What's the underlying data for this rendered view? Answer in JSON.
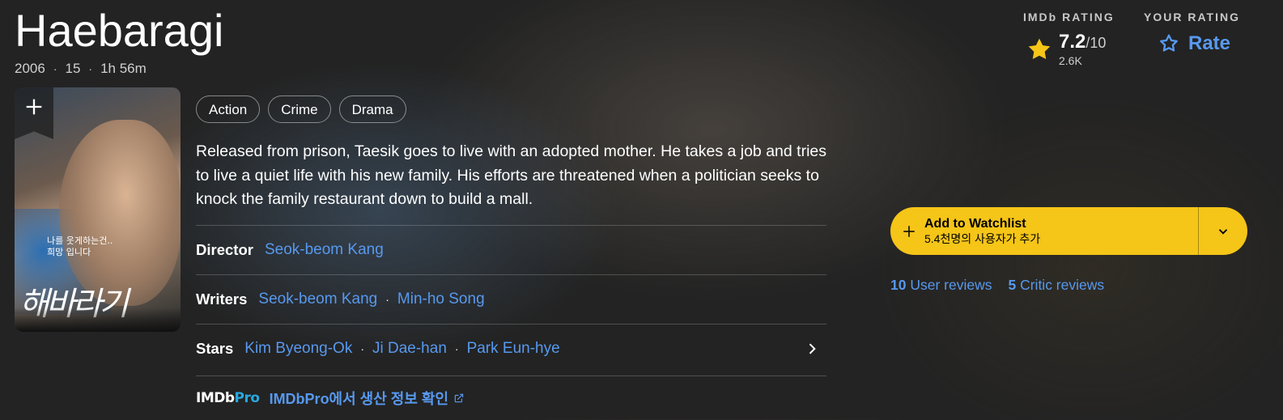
{
  "title": {
    "name": "Haebaragi",
    "year": "2006",
    "certificate": "15",
    "runtime": "1h 56m"
  },
  "poster": {
    "text_line1": "나를 웃게하는건..",
    "text_line2": "희망 입니다",
    "big_title": "해바라기"
  },
  "genres": [
    "Action",
    "Crime",
    "Drama"
  ],
  "plot": "Released from prison, Taesik goes to live with an adopted mother. He takes a job and tries to live a quiet life with his new family. His efforts are threatened when a politician seeks to knock the family restaurant down to build a mall.",
  "credits": {
    "director_label": "Director",
    "directors": [
      "Seok-beom Kang"
    ],
    "writers_label": "Writers",
    "writers": [
      "Seok-beom Kang",
      "Min-ho Song"
    ],
    "stars_label": "Stars",
    "stars": [
      "Kim Byeong-Ok",
      "Ji Dae-han",
      "Park Eun-hye"
    ]
  },
  "imdbpro": {
    "logo_imdb": "IMDb",
    "logo_pro": "Pro",
    "link": "IMDbPro에서 생산 정보 확인"
  },
  "rating": {
    "imdb_label": "IMDb RATING",
    "value": "7.2",
    "out_of": "/10",
    "count": "2.6K",
    "your_label": "YOUR RATING",
    "rate_label": "Rate"
  },
  "watchlist": {
    "label": "Add to Watchlist",
    "sub": "5.4천명의 사용자가 추가"
  },
  "reviews": {
    "user_count": "10",
    "user_label": "User reviews",
    "critic_count": "5",
    "critic_label": "Critic reviews"
  },
  "colors": {
    "accent_yellow": "#f5c518",
    "link_blue": "#5799ef"
  }
}
